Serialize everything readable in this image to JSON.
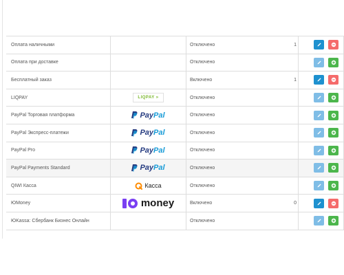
{
  "rows": [
    {
      "name": "Оплата наличными",
      "status": "Отключено",
      "sort": "1"
    },
    {
      "name": "Оплата при доставке",
      "status": "Отключено",
      "sort": ""
    },
    {
      "name": "Бесплатный заказ",
      "status": "Включено",
      "sort": "1"
    },
    {
      "name": "LIQPAY",
      "status": "Отключено",
      "sort": "",
      "logo": "LIQPAY"
    },
    {
      "name": "PayPal Торговая платформа",
      "status": "Отключено",
      "sort": "",
      "logo_a": "Pay",
      "logo_b": "Pal"
    },
    {
      "name": "PayPal Экспресс-платежи",
      "status": "Отключено",
      "sort": "",
      "logo_a": "Pay",
      "logo_b": "Pal"
    },
    {
      "name": "PayPal Pro",
      "status": "Отключено",
      "sort": "",
      "logo_a": "Pay",
      "logo_b": "Pal"
    },
    {
      "name": "PayPal Payments Standard",
      "status": "Отключено",
      "sort": "",
      "logo_a": "Pay",
      "logo_b": "Pal"
    },
    {
      "name": "QIWI Касса",
      "status": "Отключено",
      "sort": "",
      "logo": "Касса"
    },
    {
      "name": "ЮMoney",
      "status": "Включено",
      "sort": "0",
      "logo": "money"
    },
    {
      "name": "ЮKassa: Сбербанк Бизнес Онлайн",
      "status": "Отключено",
      "sort": ""
    }
  ],
  "colors": {
    "edit": "#1e91cf",
    "edit_disabled": "#7fbde6",
    "delete": "#f56b6b",
    "install": "#4cb64c",
    "paypal_dark": "#253b80",
    "paypal_light": "#179bd7",
    "liqpay": "#7ab72b",
    "qiwi": "#ff8c00",
    "yoomoney": "#7a3ff2"
  },
  "icons": {
    "edit": "pencil-icon",
    "delete": "minus-circle-icon",
    "install": "plus-circle-icon"
  }
}
